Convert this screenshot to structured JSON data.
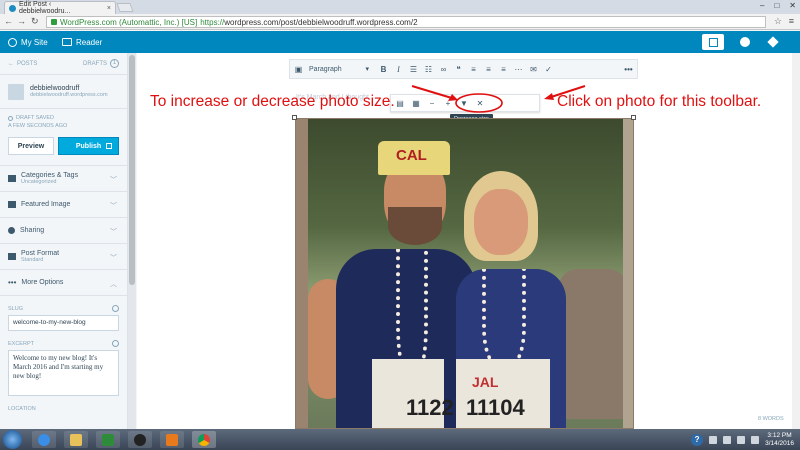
{
  "browser": {
    "tab_title": "Edit Post ‹ debbielwoodru...",
    "tab_close": "×",
    "site_identity": "WordPress.com (Automattic, Inc.) [US]",
    "url": "https://wordpress.com/post/debbielwoodruff.wordpress.com/2",
    "url_prefix": "https://",
    "url_rest": "wordpress.com/post/debbielwoodruff.wordpress.com/2"
  },
  "masterbar": {
    "my_site": "My Site",
    "reader": "Reader"
  },
  "sidebar": {
    "posts_label": "POSTS",
    "drafts_label": "DRAFTS",
    "drafts_count": "1",
    "site_name": "debbielwoodruff",
    "site_url": "debbielwoodruff.wordpress.com",
    "status_saved": "DRAFT SAVED",
    "status_time": "A FEW SECONDS AGO",
    "preview_label": "Preview",
    "publish_label": "Publish",
    "sections": [
      {
        "label": "Categories & Tags",
        "sub": "Uncategorized"
      },
      {
        "label": "Featured Image",
        "sub": ""
      },
      {
        "label": "Sharing",
        "sub": ""
      },
      {
        "label": "Post Format",
        "sub": "Standard"
      },
      {
        "label": "More Options",
        "sub": ""
      }
    ],
    "slug_label": "SLUG",
    "slug_value": "welcome-to-my-new-blog",
    "excerpt_label": "EXCERPT",
    "excerpt_value": "Welcome to my new blog! It's March 2016 and I'm starting my new blog!",
    "location_label": "LOCATION"
  },
  "editor": {
    "format_select": "Paragraph",
    "background_text": "It's March and I thought",
    "tooltip": "Decrease size",
    "word_count": "8 WORDS",
    "photo_hat_text": "CAL",
    "photo_bib_name": "JAL",
    "photo_bib_number_left": "1122",
    "photo_bib_number_right": "11104"
  },
  "annotations": {
    "left": "To increase or decrease photo size.",
    "right": "Click on photo for this toolbar.",
    "color": "#e01010"
  },
  "taskbar": {
    "time": "3:12 PM",
    "date": "3/14/2016"
  }
}
